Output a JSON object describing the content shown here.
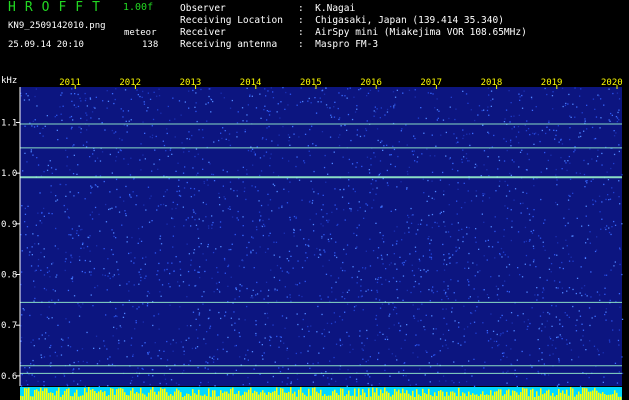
{
  "header": {
    "app_name": "HROFFT",
    "version": "1.00f",
    "filename": "KN9_2509142010.png",
    "mode": "meteor",
    "datetime": "25.09.14 20:10",
    "count": "138"
  },
  "info": [
    {
      "label": "Observer",
      "value": "K.Nagai"
    },
    {
      "label": "Receiving Location",
      "value": "Chigasaki, Japan (139.414 35.340)"
    },
    {
      "label": "Receiver",
      "value": "AirSpy mini (Miakejima VOR 108.65MHz)"
    },
    {
      "label": "Receiving antenna",
      "value": "Maspro FM-3"
    }
  ],
  "spectrogram": {
    "unit": "kHz",
    "x_ticks": [
      "2011",
      "2012",
      "2013",
      "2014",
      "2015",
      "2016",
      "2017",
      "2018",
      "2019",
      "2020"
    ],
    "y_ticks": [
      "1.1",
      "1.0",
      "0.9",
      "0.8",
      "0.7",
      "0.6"
    ],
    "y_values": [
      1.1,
      1.0,
      0.9,
      0.8,
      0.7,
      0.6
    ],
    "y_range": [
      0.58,
      1.17
    ],
    "signal_lines_khz": [
      1.097,
      1.05,
      0.992,
      0.745,
      0.62,
      0.605
    ],
    "colors": {
      "background": "#0c1580",
      "noise": "#3a6cff",
      "signal": "#9fffd0",
      "tick": "#ffff00",
      "base": "#00d8ff"
    }
  }
}
